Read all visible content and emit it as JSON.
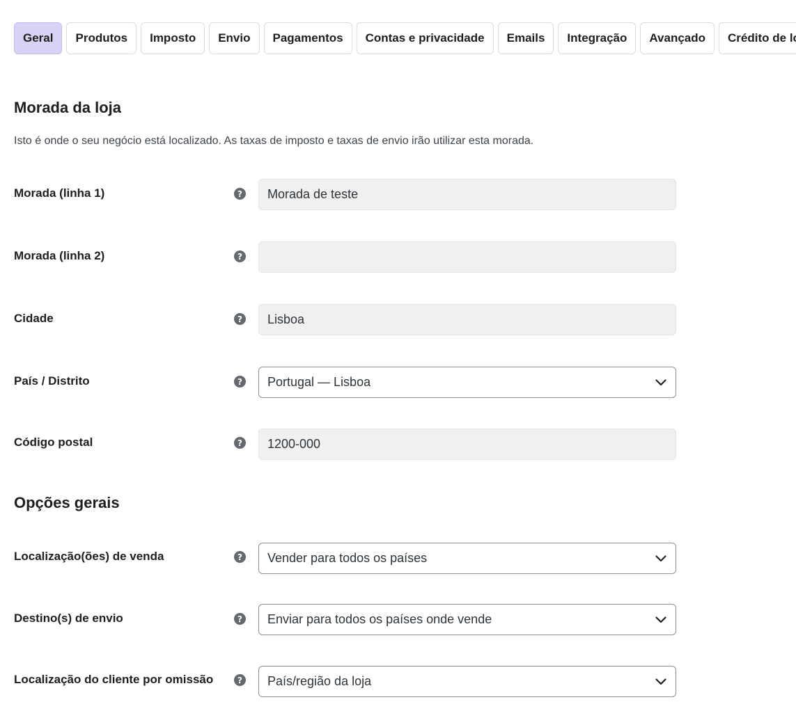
{
  "tabs": [
    {
      "label": "Geral",
      "active": true
    },
    {
      "label": "Produtos"
    },
    {
      "label": "Imposto"
    },
    {
      "label": "Envio"
    },
    {
      "label": "Pagamentos"
    },
    {
      "label": "Contas e privacidade"
    },
    {
      "label": "Emails"
    },
    {
      "label": "Integração"
    },
    {
      "label": "Avançado"
    },
    {
      "label": "Crédito de loja"
    }
  ],
  "store_address": {
    "title": "Morada da loja",
    "description": "Isto é onde o seu negócio está localizado. As taxas de imposto e taxas de envio irão utilizar esta morada.",
    "address_1": {
      "label": "Morada (linha 1)",
      "value": "Morada de teste"
    },
    "address_2": {
      "label": "Morada (linha 2)",
      "value": ""
    },
    "city": {
      "label": "Cidade",
      "value": "Lisboa"
    },
    "country": {
      "label": "País / Distrito",
      "value": "Portugal — Lisboa"
    },
    "postcode": {
      "label": "Código postal",
      "value": "1200-000"
    }
  },
  "general_options": {
    "title": "Opções gerais",
    "selling_locations": {
      "label": "Localização(ões) de venda",
      "value": "Vender para todos os países"
    },
    "shipping_locations": {
      "label": "Destino(s) de envio",
      "value": "Enviar para todos os países onde vende"
    },
    "default_customer_location": {
      "label": "Localização do cliente por omissão",
      "value": "País/região da loja"
    }
  },
  "icons": {
    "help": "question-circle-icon",
    "dropdown": "chevron-down-icon"
  },
  "colors": {
    "active_tab": "#d9d2f5",
    "field_bg": "#f0f0f1",
    "help_icon": "#646970"
  }
}
